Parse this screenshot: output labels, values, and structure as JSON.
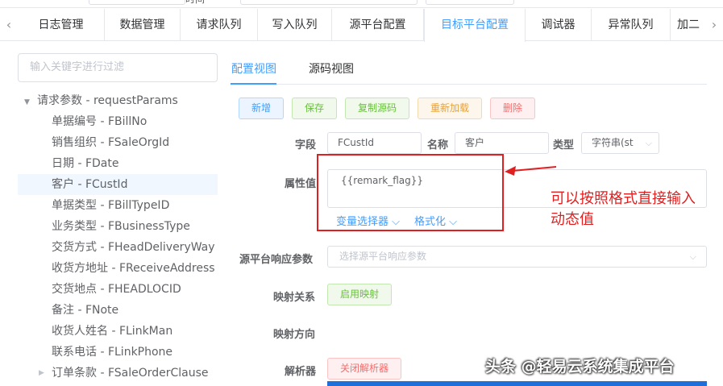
{
  "top_strip": {
    "cut_label": "时间"
  },
  "tabs": {
    "scroll_left_icon": "‹",
    "scroll_right_icon": "›",
    "items": [
      {
        "label": "日志管理"
      },
      {
        "label": "数据管理"
      },
      {
        "label": "请求队列"
      },
      {
        "label": "写入队列"
      },
      {
        "label": "源平台配置"
      },
      {
        "label": "目标平台配置",
        "active": true
      },
      {
        "label": "调试器"
      },
      {
        "label": "异常队列"
      },
      {
        "label": "加二"
      }
    ]
  },
  "tree": {
    "filter_placeholder": "输入关键字进行过滤",
    "root_label": "请求参数 - requestParams",
    "items": [
      {
        "label": "单据编号 - FBillNo"
      },
      {
        "label": "销售组织 - FSaleOrgId"
      },
      {
        "label": "日期 - FDate"
      },
      {
        "label": "客户 - FCustId",
        "selected": true
      },
      {
        "label": "单据类型 - FBillTypeID"
      },
      {
        "label": "业务类型 - FBusinessType"
      },
      {
        "label": "交货方式 - FHeadDeliveryWay"
      },
      {
        "label": "收货方地址 - FReceiveAddress"
      },
      {
        "label": "交货地点 - FHEADLOCID"
      },
      {
        "label": "备注 - FNote"
      },
      {
        "label": "收货人姓名 - FLinkMan"
      },
      {
        "label": "联系电话 - FLinkPhone"
      },
      {
        "label": "订单条款 - FSaleOrderClause",
        "expandable": true
      }
    ]
  },
  "view_tabs": {
    "config": "配置视图",
    "source": "源码视图"
  },
  "toolbar": {
    "add": "新增",
    "save": "保存",
    "copy_source": "复制源码",
    "reload": "重新加载",
    "delete": "删除"
  },
  "form": {
    "field_label": "字段",
    "field_value": "FCustId",
    "name_label": "名称",
    "name_value": "客户",
    "type_label": "类型",
    "type_value": "字符串(st",
    "attr_label": "属性值",
    "attr_value": "{{remark_flag}}",
    "var_selector": "变量选择器",
    "formatter": "格式化",
    "source_resp_label": "源平台响应参数",
    "source_resp_placeholder": "选择源平台响应参数",
    "mapping_label": "映射关系",
    "mapping_button": "启用映射",
    "direction_label": "映射方向",
    "parser_label": "解析器",
    "parser_button": "关闭解析器"
  },
  "annotation": {
    "text": "可以按照格式直接输入动态值",
    "color": "#e02020"
  },
  "watermark": "头条 @轻易云系统集成平台",
  "colors": {
    "accent": "#409eff",
    "success": "#67c23a",
    "warning": "#e6a23c",
    "danger": "#f56c6c"
  }
}
